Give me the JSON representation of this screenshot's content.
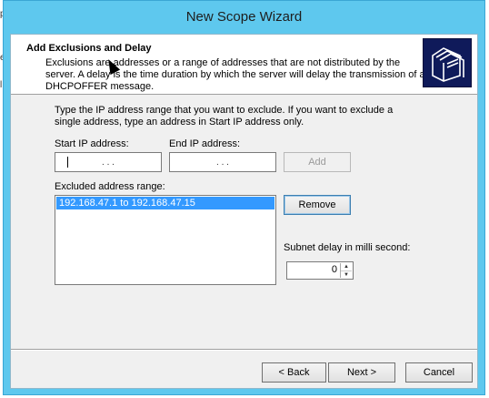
{
  "side_fragments": [
    "p",
    "e",
    "l"
  ],
  "window": {
    "title": "New Scope Wizard"
  },
  "header": {
    "title": "Add Exclusions and Delay",
    "description": "Exclusions are addresses or a range of addresses that are not distributed by the server. A delay is the time duration by which the server will delay the transmission of a DHCPOFFER message.",
    "icon": "folders-icon"
  },
  "body": {
    "instructions": "Type the IP address range that you want to exclude. If you want to exclude a single address, type an address in Start IP address only.",
    "start_ip": {
      "label": "Start IP address:",
      "value": ". . ."
    },
    "end_ip": {
      "label": "End IP address:",
      "value": ". . ."
    },
    "add_label": "Add",
    "excluded_label": "Excluded address range:",
    "excluded_items": [
      "192.168.47.1 to 192.168.47.15"
    ],
    "remove_label": "Remove",
    "delay_label": "Subnet delay in milli second:",
    "delay_value": "0"
  },
  "footer": {
    "back_label": "< Back",
    "next_label": "Next >",
    "cancel_label": "Cancel"
  }
}
